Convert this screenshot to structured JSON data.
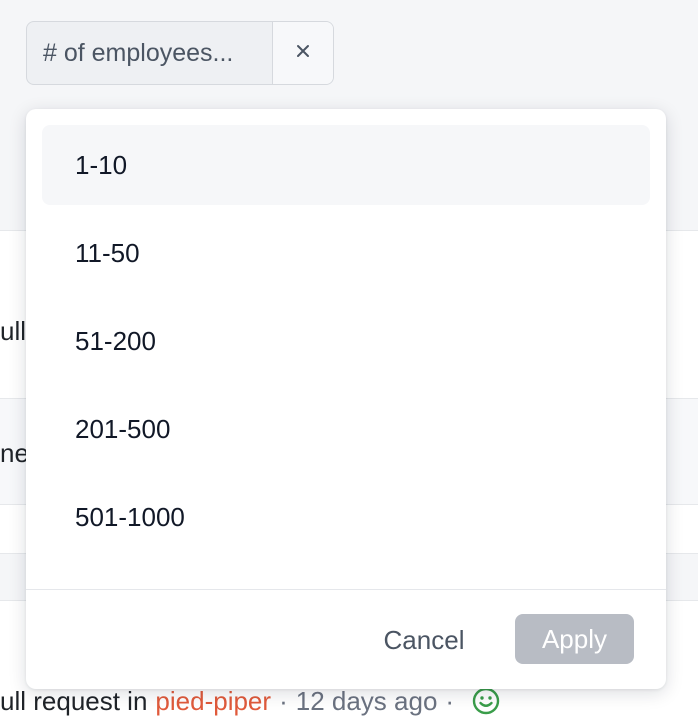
{
  "filter_chip": {
    "label": "# of employees...",
    "clear_glyph": "×"
  },
  "dropdown": {
    "options": [
      {
        "label": "1-10"
      },
      {
        "label": "11-50"
      },
      {
        "label": "51-200"
      },
      {
        "label": "201-500"
      },
      {
        "label": "501-1000"
      }
    ],
    "cancel_label": "Cancel",
    "apply_label": "Apply"
  },
  "background": {
    "fragment_1": "ull",
    "fragment_2": "net",
    "activity": {
      "text": "ull request in",
      "repo": "pied-piper",
      "separator": "·",
      "time": "12 days ago",
      "reaction_icon": "smiley-icon"
    }
  },
  "colors": {
    "repo_link": "#e05a3b",
    "apply_disabled_bg": "#b8bcc4",
    "reaction_green": "#3a9d4a"
  }
}
